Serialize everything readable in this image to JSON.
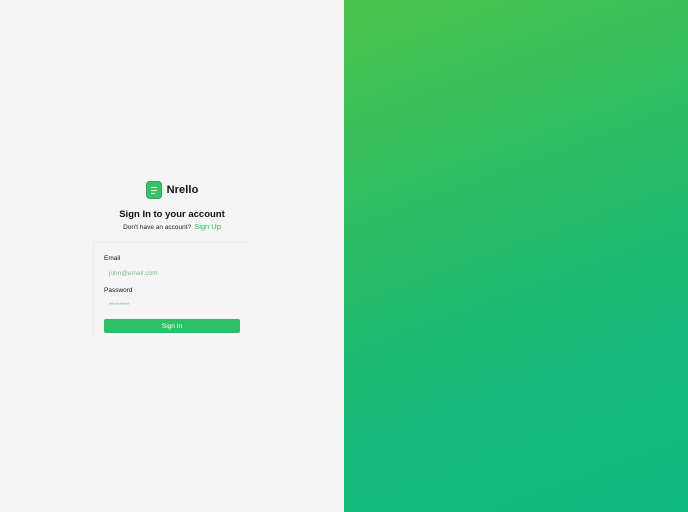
{
  "brand": {
    "name": "Nrello",
    "logo_icon": "document-icon"
  },
  "auth": {
    "title": "Sign In to your account",
    "no_account_text": "Don't have an account?",
    "signup_link": "Sign Up"
  },
  "form": {
    "email_label": "Email",
    "email_placeholder": "john@email.com",
    "password_label": "Password",
    "password_placeholder": "********",
    "submit_label": "Sign In"
  },
  "colors": {
    "accent": "#22c55e",
    "button": "#2fbf66",
    "gradient_start": "#4cc44c",
    "gradient_end": "#10b981",
    "left_background": "#f5f5f5"
  }
}
